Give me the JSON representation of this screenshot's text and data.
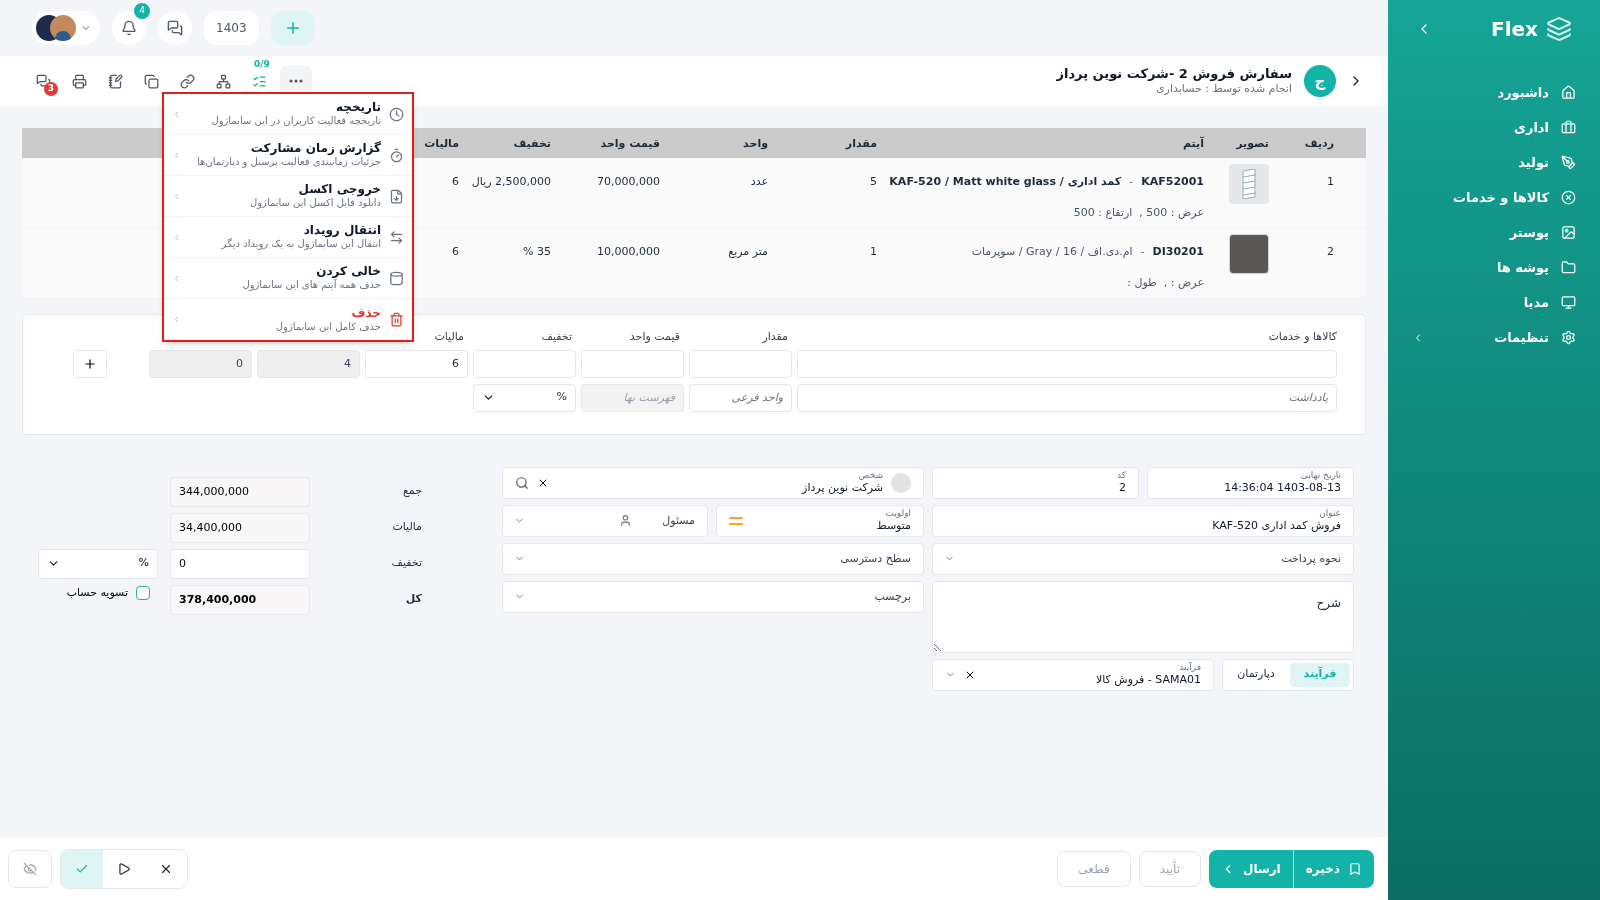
{
  "sidebar": {
    "logo": "Flex",
    "items": [
      {
        "label": "داشبورد",
        "has_submenu": false
      },
      {
        "label": "اداری",
        "has_submenu": false
      },
      {
        "label": "تولید",
        "has_submenu": false
      },
      {
        "label": "کالاها و خدمات",
        "has_submenu": false
      },
      {
        "label": "پوستر",
        "has_submenu": false
      },
      {
        "label": "پوشه ها",
        "has_submenu": false
      },
      {
        "label": "مدیا",
        "has_submenu": false
      },
      {
        "label": "تنظیمات",
        "has_submenu": true
      }
    ]
  },
  "topbar": {
    "notification_count": "4",
    "year": "1403"
  },
  "header": {
    "avatar_letter": "ج",
    "title": "سفارش فروش 2 -شرکت نوین پرداز",
    "subtitle": "انجام شده توسط : حسابداری"
  },
  "toolbar": {
    "comments_count": "3",
    "checklist_count": "0/9"
  },
  "more_menu": {
    "items": [
      {
        "kind": "normal",
        "title": "تاریخچه",
        "description": "تاریخچه فعالیت کاربران در این سابماژول"
      },
      {
        "kind": "normal",
        "title": "گزارش زمان مشارکت",
        "description": "جزئیات زمانبندی فعالیت پرسنل و دپارتمان‌ها"
      },
      {
        "kind": "normal",
        "title": "خروجی اکسل",
        "description": "دانلود فایل اکسل این سابماژول"
      },
      {
        "kind": "normal",
        "title": "انتقال رویداد",
        "description": "انتقال این سابماژول به یک رویداد دیگر"
      },
      {
        "kind": "normal",
        "title": "خالی کردن",
        "description": "حذف همه آیتم های این سابماژول"
      },
      {
        "kind": "danger",
        "title": "حذف",
        "description": "حذف کامل این سابماژول"
      }
    ]
  },
  "items_table": {
    "columns": [
      "ردیف",
      "تصویر",
      "آیتم",
      "مقدار",
      "واحد",
      "قیمت واحد",
      "تخفیف",
      "مالیات"
    ],
    "rows": [
      {
        "index": "1",
        "thumbnail": {
          "kind": "shelf"
        },
        "code": "KAF52001",
        "code_separator": "-",
        "name": "کمد اداری / KAF-520 / Matt white glass",
        "emphasized": true,
        "details": "عرض : 500 ,  ارتفاع : 500",
        "quantity": "5",
        "unit": "عدد",
        "unit_price": "70,000,000",
        "discount": "2,500,000 ریال",
        "tax": "6"
      },
      {
        "index": "2",
        "thumbnail": {
          "kind": "swatch"
        },
        "code": "DI30201",
        "code_separator": "-",
        "name": "ام.دی.اف / 16 / Gray / سوپرمات",
        "emphasized": false,
        "details": "عرض : ,  طول :",
        "quantity": "1",
        "unit": "متر مربع",
        "unit_price": "10,000,000",
        "discount": "35 %",
        "tax": "6"
      }
    ]
  },
  "entry": {
    "row1": [
      {
        "label": "کالاها و خدمات",
        "disabled": false
      },
      {
        "label": "مقدار",
        "disabled": false
      },
      {
        "label": "قیمت واحد",
        "disabled": false
      },
      {
        "label": "تخفیف",
        "disabled": false
      },
      {
        "label": "مالیات",
        "value": "6",
        "disabled": false
      },
      {
        "value": "4",
        "disabled": true
      },
      {
        "value": "0",
        "disabled": true
      }
    ],
    "row2": [
      {
        "kind": "text",
        "placeholder": "یادداشت",
        "disabled": false
      },
      {
        "kind": "text",
        "placeholder": "واحد فرعی",
        "disabled": false
      },
      {
        "kind": "text",
        "placeholder": "فهرست بها",
        "disabled": true
      },
      {
        "kind": "select",
        "value": "%",
        "disabled": false
      }
    ]
  },
  "order_form": {
    "fields": [
      {
        "kind": "text",
        "label": "تاریخ نهایی",
        "value": "1403-08-13 14:36:04"
      },
      {
        "kind": "text",
        "label": "کد",
        "value": "2"
      },
      {
        "kind": "person",
        "label": "شخص",
        "value": "شرکت نوین پرداز"
      },
      {
        "kind": "text",
        "label": "عنوان",
        "value": "فروش کمد اداری KAF-520"
      },
      {
        "kind": "priority",
        "label": "اولویت",
        "value": "متوسط"
      },
      {
        "kind": "user_select",
        "placeholder": "مسئول"
      },
      {
        "kind": "select",
        "placeholder": "نحوه پرداخت"
      },
      {
        "kind": "select",
        "placeholder": "سطح دسترسی"
      },
      {
        "kind": "textarea",
        "placeholder": "شرح"
      },
      {
        "kind": "select",
        "placeholder": "برچسب"
      }
    ],
    "tabs": [
      {
        "label": "فرآیند",
        "selected": true
      },
      {
        "label": "دپارتمان",
        "selected": false
      }
    ],
    "process_field": {
      "label": "فرآیند",
      "value": "SAMA01 - فروش کالا"
    }
  },
  "totals": {
    "rows": [
      {
        "kind": "readonly",
        "label": "جمع",
        "value": "344,000,000"
      },
      {
        "kind": "readonly",
        "label": "مالیات",
        "value": "34,400,000"
      },
      {
        "kind": "input",
        "label": "تخفیف",
        "value": "0",
        "unit": "%"
      },
      {
        "kind": "total",
        "label": "کل",
        "value": "378,400,000"
      }
    ],
    "settle": {
      "label": "تسویه حساب",
      "checked": false
    }
  },
  "footer": {
    "status_buttons": [
      {
        "selected": true
      },
      {
        "selected": false
      },
      {
        "selected": false
      }
    ],
    "actions": [
      {
        "kind": "primary",
        "label": "ذخیره",
        "disabled": false
      },
      {
        "kind": "primary",
        "label": "ارسال",
        "disabled": false
      },
      {
        "kind": "secondary",
        "label": "تأیید",
        "disabled": true
      },
      {
        "kind": "secondary",
        "label": "قطعی",
        "disabled": true
      }
    ]
  }
}
